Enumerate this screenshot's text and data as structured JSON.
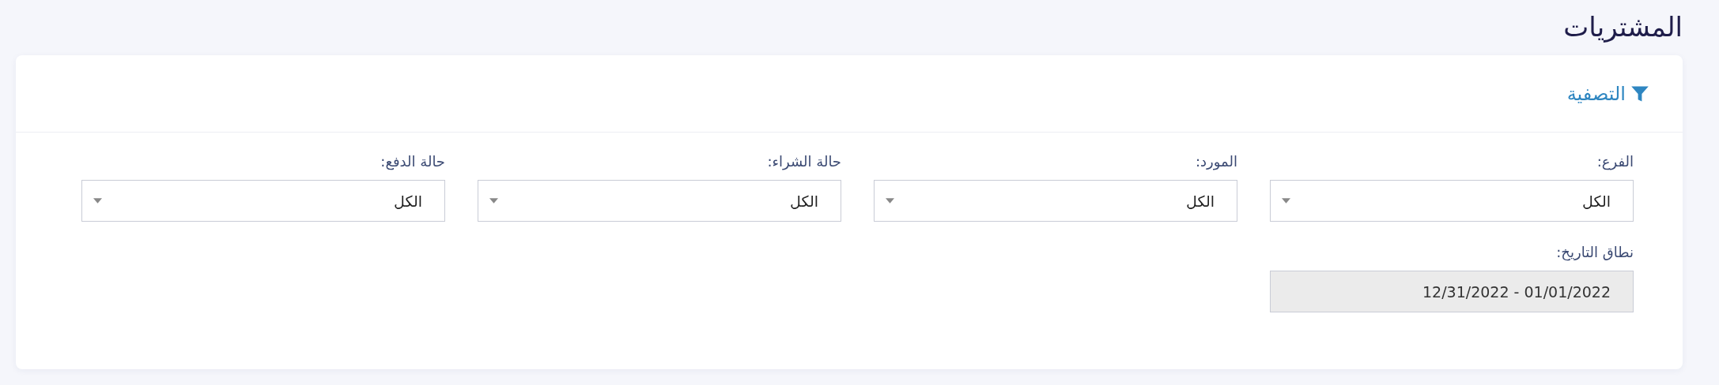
{
  "page": {
    "title": "المشتريات"
  },
  "filter_card": {
    "heading": "التصفية",
    "selects": [
      {
        "label": "الفرع:",
        "value": "الكل"
      },
      {
        "label": "المورد:",
        "value": "الكل"
      },
      {
        "label": "حالة الشراء:",
        "value": "الكل"
      },
      {
        "label": "حالة الدفع:",
        "value": "الكل"
      }
    ],
    "date_range": {
      "label": "نطاق التاريخ:",
      "value": "12/31/2022 - 01/01/2022"
    }
  }
}
